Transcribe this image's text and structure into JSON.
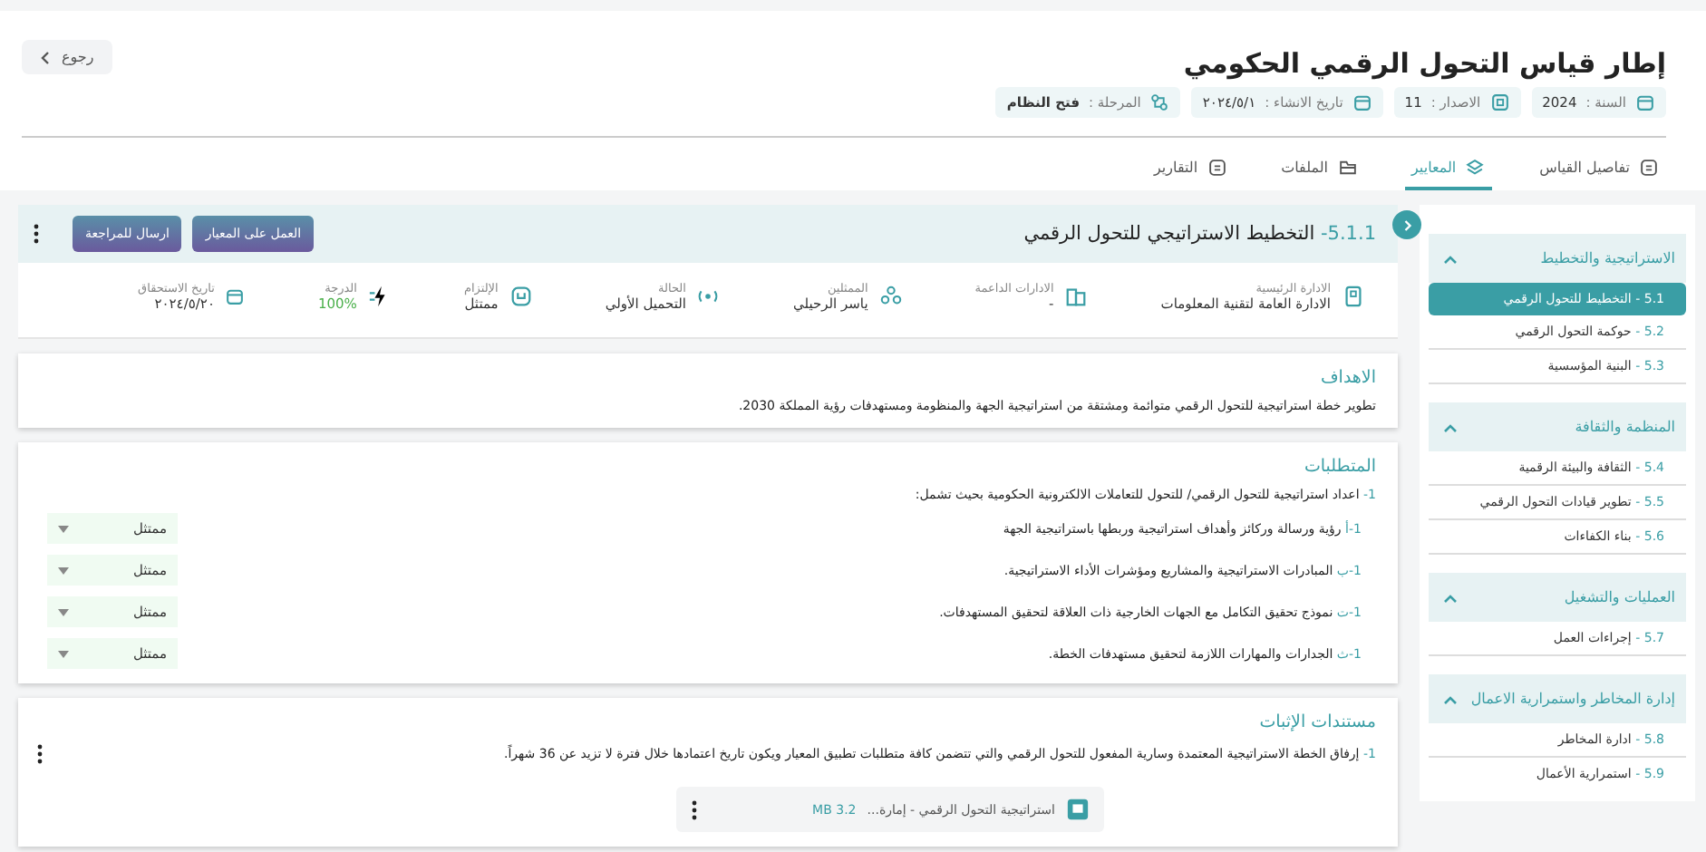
{
  "header": {
    "title": "إطار قياس التحول الرقمي الحكومي",
    "back_button": "رجوع",
    "meta": [
      {
        "kind": "calendar",
        "label": "السنة :",
        "value": "2024"
      },
      {
        "kind": "version",
        "label": "الاصدار :",
        "value": "11"
      },
      {
        "kind": "calendar",
        "label": "تاريخ الانشاء :",
        "value": "٢٠٢٤/٥/١"
      },
      {
        "kind": "stage",
        "label": "المرحلة :",
        "value": "فتح النظام"
      }
    ]
  },
  "tabs": [
    {
      "label": "تفاصيل القياس",
      "selected": false
    },
    {
      "label": "المعايير",
      "selected": true
    },
    {
      "label": "الملفات",
      "selected": false
    },
    {
      "label": "التقارير",
      "selected": false
    }
  ],
  "sidebar": {
    "groups": [
      {
        "title": "الاستراتيجية والتخطيط",
        "expanded": true,
        "items": [
          {
            "number": "5.1 -",
            "label": "التخطيط للتحول الرقمي",
            "selected": true
          },
          {
            "number": "5.2 -",
            "label": "حوكمة التحول الرقمي",
            "selected": false
          },
          {
            "number": "5.3 -",
            "label": "البنية المؤسسية",
            "selected": false
          }
        ]
      },
      {
        "title": "المنظمة والثقافة",
        "expanded": true,
        "items": [
          {
            "number": "5.4 -",
            "label": "الثقافة والبيئة الرقمية",
            "selected": false
          },
          {
            "number": "5.5 -",
            "label": "تطوير قيادات التحول الرقمي",
            "selected": false
          },
          {
            "number": "5.6 -",
            "label": "بناء الكفاءات",
            "selected": false
          }
        ]
      },
      {
        "title": "العمليات والتشغيل",
        "expanded": true,
        "items": [
          {
            "number": "5.7 -",
            "label": "إجراءات العمل",
            "selected": false
          }
        ]
      },
      {
        "title": "إدارة المخاطر واستمرارية الاعمال",
        "expanded": true,
        "items": [
          {
            "number": "5.8 -",
            "label": "ادارة المخاطر",
            "selected": false
          },
          {
            "number": "5.9 -",
            "label": "استمرارية الأعمال",
            "selected": false
          }
        ]
      }
    ]
  },
  "standard": {
    "number": "5.1.1-",
    "title": "التخطيط الاستراتيجي للتحول الرقمي",
    "buttons": [
      "العمل على المعيار",
      "ارسال للمراجعة"
    ],
    "info": [
      {
        "kind": "building",
        "label": "الادارة الرئيسية",
        "value": "الادارة العامة لتقنية المعلومات"
      },
      {
        "kind": "buildings",
        "label": "الادارات الداعمة",
        "value": "-"
      },
      {
        "kind": "people",
        "label": "الممثلين",
        "value": "ياسر الرحيلي"
      },
      {
        "kind": "status",
        "label": "الحالة",
        "value": "التحميل الأولي"
      },
      {
        "kind": "commitment",
        "label": "الإلتزام",
        "value": "ممتثل"
      },
      {
        "kind": "score",
        "label": "الدرجة",
        "value": "100%"
      },
      {
        "kind": "calendar",
        "label": "تاريخ الاستحقاق",
        "value": "٢٠٢٤/٥/٢٠"
      }
    ]
  },
  "objectives": {
    "title": "الاهداف",
    "text": "تطوير خطة استراتيجية للتحول الرقمي متوائمة ومشتقة من استراتيجية الجهة والمنظومة ومستهدفات رؤية المملكة 2030."
  },
  "requirements": {
    "title": "المتطلبات",
    "main": {
      "prefix": "1-",
      "text": "اعداد استراتيجية للتحول الرقمي/ للتحول للتعاملات الالكترونية الحكومية بحيث تشمل:"
    },
    "items": [
      {
        "prefix": "1-أ",
        "text": "رؤية ورسالة وركائز وأهداف استراتيجية وربطها باستراتيجية الجهة",
        "status": "ممتثل"
      },
      {
        "prefix": "1-ب",
        "text": "المبادرات الاستراتيجية والمشاريع ومؤشرات الأداء الاستراتيجية.",
        "status": "ممتثل"
      },
      {
        "prefix": "1-ت",
        "text": "نموذج تحقيق التكامل مع الجهات الخارجية ذات العلاقة لتحقيق المستهدفات.",
        "status": "ممتثل"
      },
      {
        "prefix": "1-ث",
        "text": "الجدارات والمهارات اللازمة لتحقيق مستهدفات الخطة.",
        "status": "ممتثل"
      }
    ]
  },
  "evidence": {
    "title": "مستندات الإثبات",
    "items": [
      {
        "prefix": "1-",
        "text": "إرفاق الخطة الاستراتيجية المعتمدة وسارية المفعول للتحول الرقمي والتي تتضمن كافة متطلبات تطبيق المعيار ويكون تاريخ اعتمادها خلال فترة لا تزيد عن 36 شهراً.",
        "file": {
          "name": "استراتيجية التحول الرقمي - إمارة...",
          "size": "3.2 MB"
        }
      }
    ]
  }
}
